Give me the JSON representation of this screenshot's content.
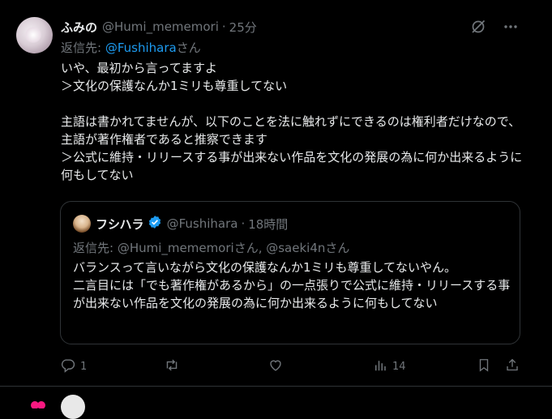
{
  "post": {
    "display_name": "ふみの",
    "handle": "@Humi_mememori",
    "separator": "·",
    "time": "25分",
    "reply_label": "返信先: ",
    "reply_mention": "@Fushihara",
    "reply_suffix": "さん",
    "body": "いや、最初から言ってますよ\n＞文化の保護なんか1ミリも尊重してない\n\n主語は書かれてませんが、以下のことを法に触れずにできるのは権利者だけなので、主語が著作権者であると推察できます\n＞公式に維持・リリースする事が出来ない作品を文化の発展の為に何か出来るように何もしてない"
  },
  "quote": {
    "display_name": "フシハラ",
    "handle": "@Fushihara",
    "separator": "·",
    "time": "18時間",
    "reply_line": "返信先: @Humi_mememoriさん, @saeki4nさん",
    "body": "バランスって言いながら文化の保護なんか1ミリも尊重してないやん。\n二言目には「でも著作権があるから」の一点張りで公式に維持・リリースする事が出来ない作品を文化の発展の為に何か出来るように何もしてない"
  },
  "actions": {
    "reply_count": "1",
    "retweet_count": "",
    "like_count": "",
    "views_count": "14"
  },
  "icons": {
    "grok": "grok-icon",
    "more": "more-icon",
    "verified": "verified-badge-icon",
    "reply": "reply-icon",
    "retweet": "retweet-icon",
    "like": "like-icon",
    "views": "views-icon",
    "bookmark": "bookmark-icon",
    "share": "share-icon"
  },
  "colors": {
    "background": "#000000",
    "text": "#e7e9ea",
    "muted": "#71767b",
    "link": "#1d9bf0",
    "border": "#2f3336",
    "verified": "#1d9bf0"
  }
}
